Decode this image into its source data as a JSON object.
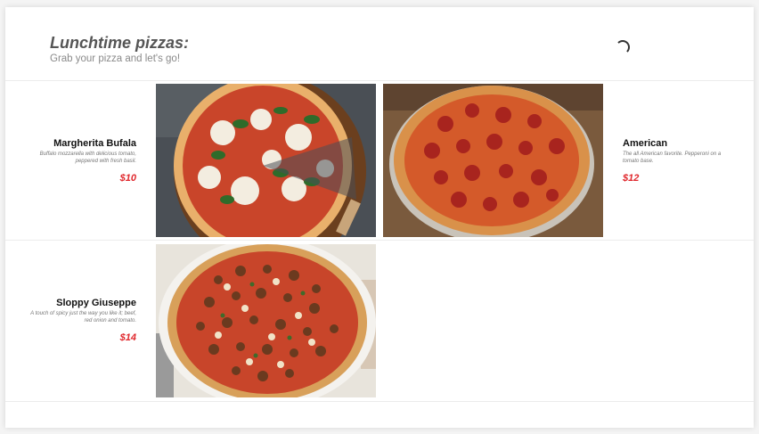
{
  "header": {
    "title": "Lunchtime pizzas:",
    "subtitle": "Grab your pizza and let's go!"
  },
  "pizzas": [
    {
      "name": "Margherita Bufala",
      "description": "Buffalo mozzarella with delicious tomato, peppered with fresh basil.",
      "price": "$10",
      "image": "margherita-pizza-photo"
    },
    {
      "name": "American",
      "description": "The all American favorite. Pepperoni on a tomato base.",
      "price": "$12",
      "image": "pepperoni-pizza-photo"
    },
    {
      "name": "Sloppy Giuseppe",
      "description": "A touch of spicy just the way you like it; beef, red onion and tomato.",
      "price": "$14",
      "image": "sausage-pizza-photo"
    }
  ],
  "colors": {
    "price": "#e0282d",
    "title": "#555555",
    "subtitle": "#8a8a8a"
  }
}
